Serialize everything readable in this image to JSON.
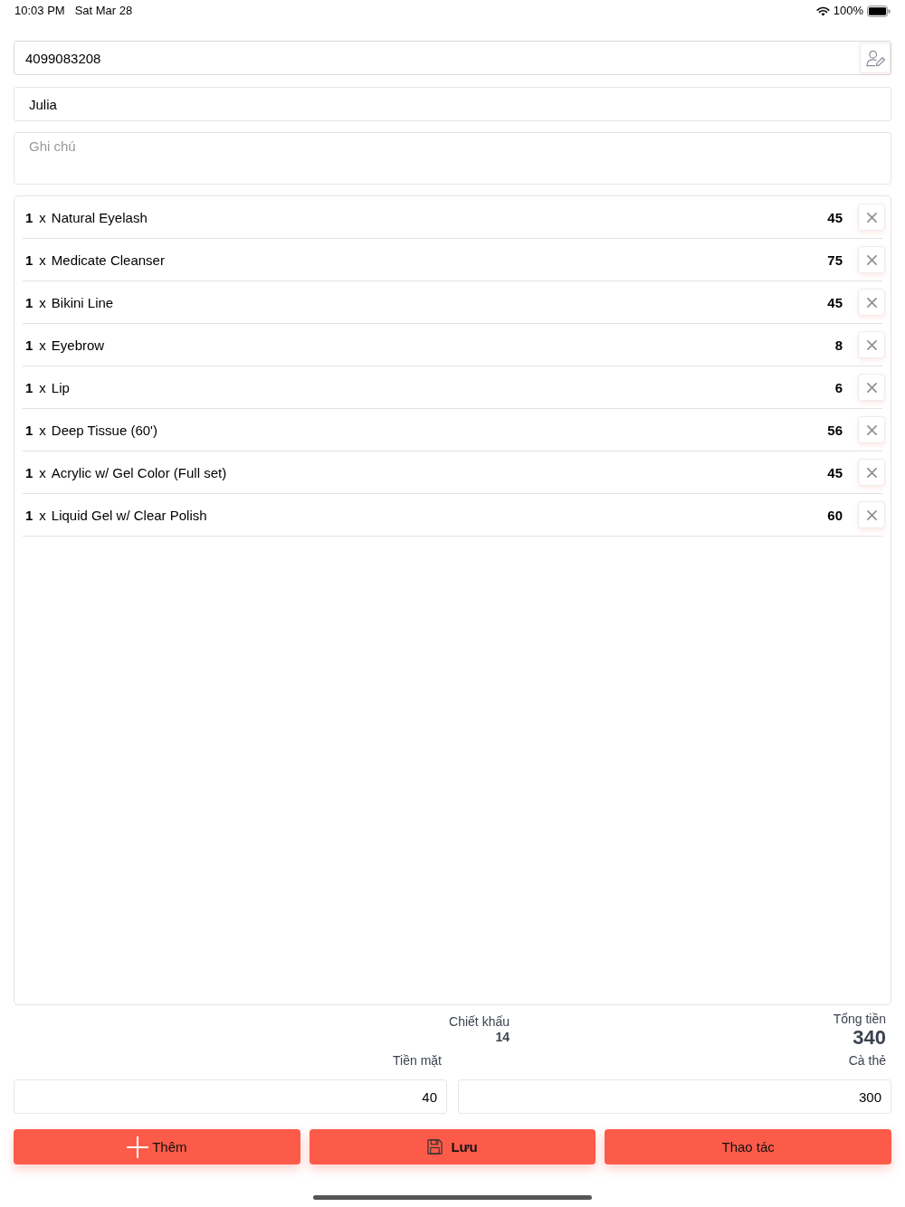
{
  "status_bar": {
    "time": "10:03 PM",
    "date": "Sat Mar 28",
    "battery": "100%"
  },
  "customer": {
    "phone": "4099083208",
    "name": "Julia",
    "note": {
      "placeholder": "Ghi chú"
    }
  },
  "items": [
    {
      "qty": "1",
      "times": "x",
      "name": "Natural Eyelash",
      "price": "45"
    },
    {
      "qty": "1",
      "times": "x",
      "name": "Medicate Cleanser",
      "price": "75"
    },
    {
      "qty": "1",
      "times": "x",
      "name": "Bikini Line",
      "price": "45"
    },
    {
      "qty": "1",
      "times": "x",
      "name": "Eyebrow",
      "price": "8"
    },
    {
      "qty": "1",
      "times": "x",
      "name": "Lip",
      "price": "6"
    },
    {
      "qty": "1",
      "times": "x",
      "name": "Deep Tissue (60')",
      "price": "56"
    },
    {
      "qty": "1",
      "times": "x",
      "name": "Acrylic w/ Gel Color (Full set)",
      "price": "45"
    },
    {
      "qty": "1",
      "times": "x",
      "name": "Liquid Gel w/ Clear Polish",
      "price": "60"
    }
  ],
  "totals": {
    "discount_label": "Chiết khấu",
    "discount": "14",
    "total_label": "Tổng tiền",
    "total": "340"
  },
  "payments": [
    {
      "label": "Tiền mặt",
      "value": "40"
    },
    {
      "label": "Cà thẻ",
      "value": "300"
    }
  ],
  "actions": [
    {
      "kind": "add",
      "label": "Thêm"
    },
    {
      "kind": "save",
      "label": "Lưu"
    },
    {
      "kind": "menu",
      "label": "Thao tác"
    }
  ]
}
